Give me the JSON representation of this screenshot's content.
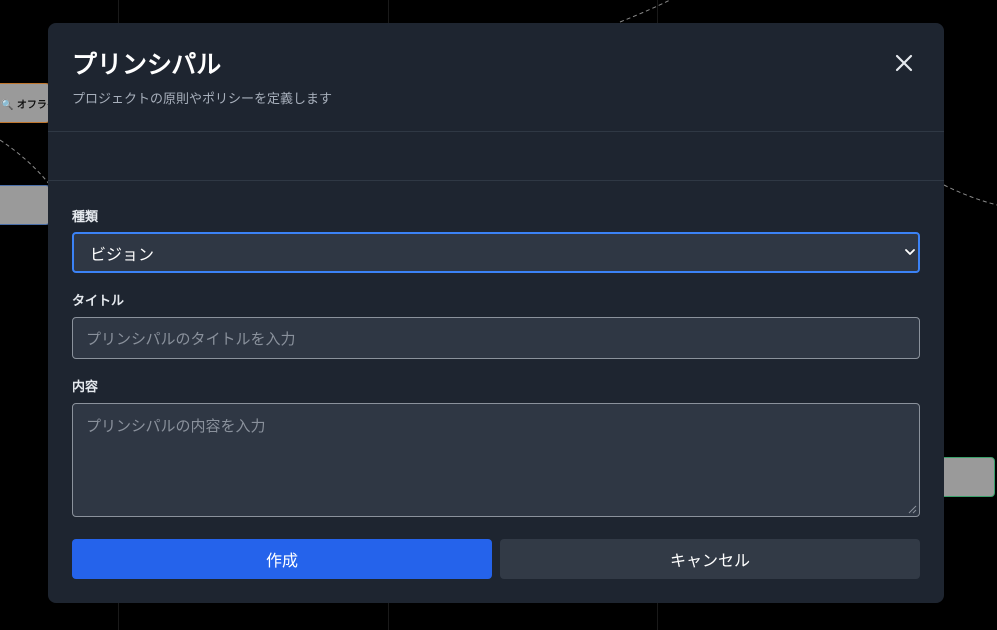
{
  "background": {
    "node_label": "🔍 オフライ"
  },
  "modal": {
    "title": "プリンシパル",
    "subtitle": "プロジェクトの原則やポリシーを定義します",
    "close_icon": "close-icon"
  },
  "form": {
    "type_label": "種類",
    "type_value": "ビジョン",
    "title_label": "タイトル",
    "title_placeholder": "プリンシパルのタイトルを入力",
    "content_label": "内容",
    "content_placeholder": "プリンシパルの内容を入力"
  },
  "actions": {
    "create_label": "作成",
    "cancel_label": "キャンセル"
  },
  "colors": {
    "accent": "#2563eb",
    "focus_border": "#3b82f6",
    "modal_bg": "#1e2530",
    "input_bg": "#2f3744"
  }
}
